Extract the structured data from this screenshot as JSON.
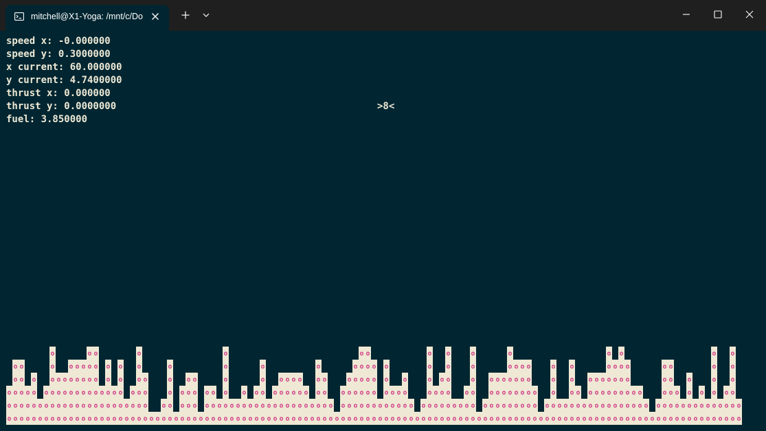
{
  "window": {
    "tab_title": "mitchell@X1-Yoga: /mnt/c/Do",
    "icons": {
      "tab": "terminal-icon",
      "tab_close": "close-icon",
      "new_tab": "plus-icon",
      "dropdown": "chevron-down-icon",
      "minimize": "minimize-icon",
      "maximize": "maximize-icon",
      "close": "close-icon"
    }
  },
  "colors": {
    "terminal_bg": "#012631",
    "text": "#eee8d5",
    "terrain_block": "#eee8d5",
    "terrain_glyph": "#d33682",
    "titlebar": "#1f1f1f"
  },
  "stats": {
    "speed_x": "speed x: -0.000000",
    "speed_y": "speed y: 0.3000000",
    "x_current": "x current: 60.000000",
    "y_current": "y current: 4.7400000",
    "thrust_x": "thrust x: 0.000000",
    "thrust_y": "thrust y: 0.0000000",
    "fuel": "fuel: 3.850000"
  },
  "lander": ">8<",
  "terrain": {
    "glyph": "o",
    "heights": [
      3,
      5,
      5,
      3,
      4,
      2,
      3,
      6,
      4,
      4,
      5,
      5,
      5,
      6,
      6,
      3,
      5,
      3,
      5,
      2,
      3,
      6,
      4,
      1,
      1,
      2,
      5,
      1,
      3,
      4,
      4,
      1,
      3,
      3,
      2,
      6,
      2,
      2,
      3,
      2,
      3,
      5,
      2,
      3,
      4,
      4,
      4,
      4,
      3,
      2,
      5,
      4,
      2,
      1,
      3,
      4,
      5,
      6,
      6,
      5,
      2,
      5,
      3,
      3,
      4,
      2,
      1,
      2,
      6,
      3,
      4,
      6,
      2,
      2,
      3,
      6,
      1,
      2,
      4,
      4,
      4,
      6,
      5,
      5,
      5,
      3,
      1,
      2,
      5,
      2,
      2,
      5,
      3,
      2,
      4,
      4,
      4,
      6,
      5,
      6,
      5,
      3,
      3,
      2,
      1,
      2,
      5,
      5,
      3,
      2,
      4,
      2,
      3,
      2,
      6,
      2,
      3,
      6,
      2,
      2,
      2,
      2,
      3,
      3
    ]
  }
}
